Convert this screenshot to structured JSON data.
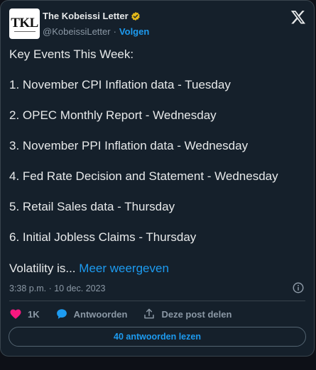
{
  "author": {
    "avatar_text": "TKL",
    "name": "The Kobeissi Letter",
    "handle": "@KobeissiLetter",
    "separator": "·",
    "follow_label": "Volgen"
  },
  "tweet": {
    "lines": [
      "Key Events This Week:",
      "1. November CPI Inflation data - Tuesday",
      "2. OPEC Monthly Report - Wednesday",
      "3. November PPI Inflation data - Wednesday",
      "4. Fed Rate Decision and Statement - Wednesday",
      "5. Retail Sales data - Thursday",
      "6. Initial Jobless Claims - Thursday"
    ],
    "last_line": "Volatility is...",
    "show_more_label": "Meer weergeven",
    "timestamp": "3:38 p.m. · 10 dec. 2023"
  },
  "actions": {
    "likes": "1K",
    "reply_label": "Antwoorden",
    "share_label": "Deze post delen"
  },
  "read_replies_label": "40 antwoorden lezen",
  "colors": {
    "background": "#15202b",
    "accent": "#1d9bf0",
    "like": "#f91880",
    "reply_icon": "#1d9bf0",
    "muted": "#8b98a5",
    "text": "#e7e9ea"
  },
  "icons": {
    "verified": "verified-badge-icon",
    "platform": "x-logo-icon",
    "info": "info-icon",
    "like": "heart-icon",
    "reply": "speech-bubble-icon",
    "share": "share-upload-icon"
  }
}
